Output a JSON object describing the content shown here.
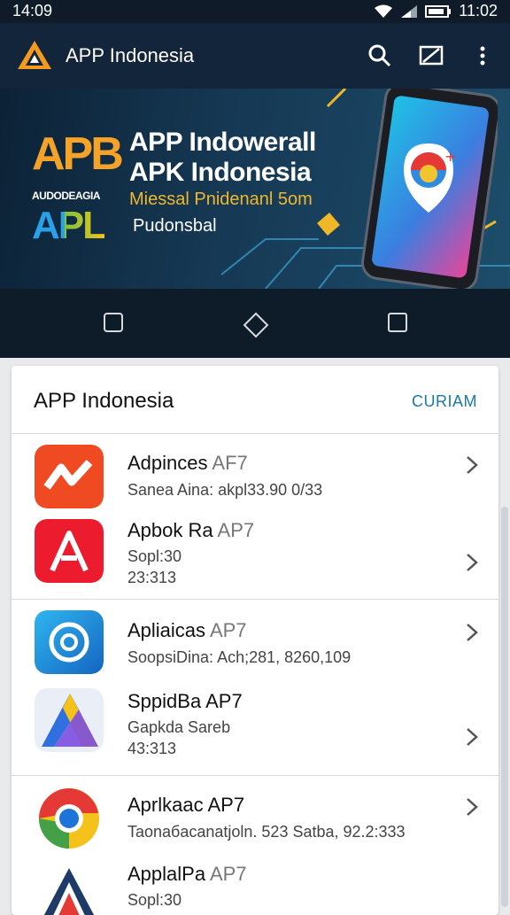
{
  "status": {
    "time_left": "14:09",
    "time_right": "11:02"
  },
  "appbar": {
    "title": "APP Indonesia"
  },
  "banner": {
    "line1": "APP Indowerall",
    "line2": "APK Indonesia",
    "line3": "Miessal Pnidenanl 5om",
    "line4": "Pudonsbal",
    "brand_small": "AUDODEAGIA",
    "brand_big": "APB",
    "brand_apl": "APL"
  },
  "card": {
    "title": "APP Indonesia",
    "action": "CURIAM",
    "items": [
      {
        "name": "Adpinces",
        "suffix": "AF7",
        "sub1": "Sanea Aina: akpl33.90 0/33",
        "sub2": ""
      },
      {
        "name": "Apbok Ra",
        "suffix": "AP7",
        "sub1": "Sopl:30",
        "sub2": "23:313"
      },
      {
        "name": "Apliaicas",
        "suffix": "AP7",
        "sub1": "SoopsiDina: Ach;281, 8260,109",
        "sub2": ""
      },
      {
        "name": "SppidBa",
        "suffix": "AP7",
        "sub1": "Gapkda Sareb",
        "sub2": "43:313"
      },
      {
        "name": "Aprlkaac",
        "suffix": "AP7",
        "sub1": "Taonaбacanatjoln. 523 Satba, 92.2:333",
        "sub2": ""
      },
      {
        "name": "ApplalPa",
        "suffix": "AP7",
        "sub1": "Sopl:30",
        "sub2": ""
      }
    ]
  }
}
